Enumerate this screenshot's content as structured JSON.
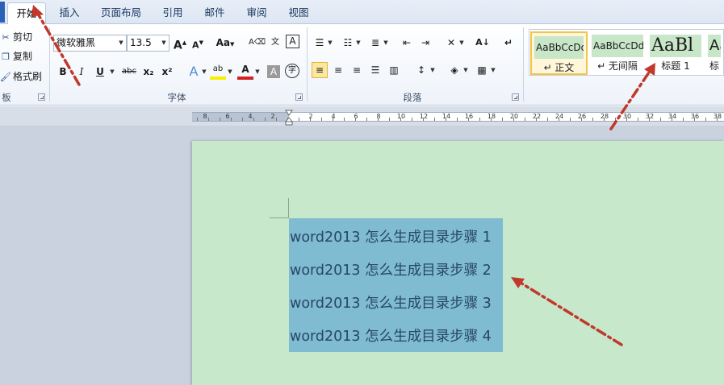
{
  "tabs": [
    {
      "label": "开始",
      "active": true
    },
    {
      "label": "插入"
    },
    {
      "label": "页面布局"
    },
    {
      "label": "引用"
    },
    {
      "label": "邮件"
    },
    {
      "label": "审阅"
    },
    {
      "label": "视图"
    }
  ],
  "clipboard": {
    "cut": "剪切",
    "copy": "复制",
    "format_painter": "格式刷",
    "group_label": "板"
  },
  "font": {
    "name": "微软雅黑",
    "size": "13.5",
    "group_label": "字体",
    "grow": "A",
    "shrink": "A",
    "change_case": "Aa",
    "bold": "B",
    "italic": "I",
    "underline": "U",
    "strikethrough": "abc",
    "subscript": "x₂",
    "superscript": "x²",
    "text_effects": "A",
    "highlight": "ab",
    "font_color": "A",
    "char_shading": "A",
    "enclose": "字",
    "phonetic": "文",
    "border_char": "A",
    "highlight_color": "#f7f000",
    "font_color_value": "#d42020"
  },
  "paragraph": {
    "group_label": "段落"
  },
  "styles": {
    "items": [
      {
        "sample": "AaBbCcDd",
        "name": "↵ 正文",
        "active": true
      },
      {
        "sample": "AaBbCcDd",
        "name": "↵ 无间隔"
      },
      {
        "sample": "AaBl",
        "name": "标题 1"
      },
      {
        "sample": "Aa",
        "name": "标"
      }
    ]
  },
  "ruler": {
    "left_labels": [
      "8",
      "6",
      "4",
      "2"
    ],
    "right_labels": [
      "2",
      "4",
      "6",
      "8",
      "10",
      "12",
      "14",
      "16",
      "18",
      "20",
      "22",
      "24",
      "26",
      "28",
      "30",
      "32",
      "34",
      "36",
      "38"
    ]
  },
  "document": {
    "lines": [
      "word2013 怎么生成目录步骤 1",
      "word2013 怎么生成目录步骤 2",
      "word2013 怎么生成目录步骤 3",
      "word2013 怎么生成目录步骤 4"
    ],
    "page_color": "#c8e8cc",
    "selection_color": "#7fbcd1",
    "annotation_color": "#c0392b"
  }
}
